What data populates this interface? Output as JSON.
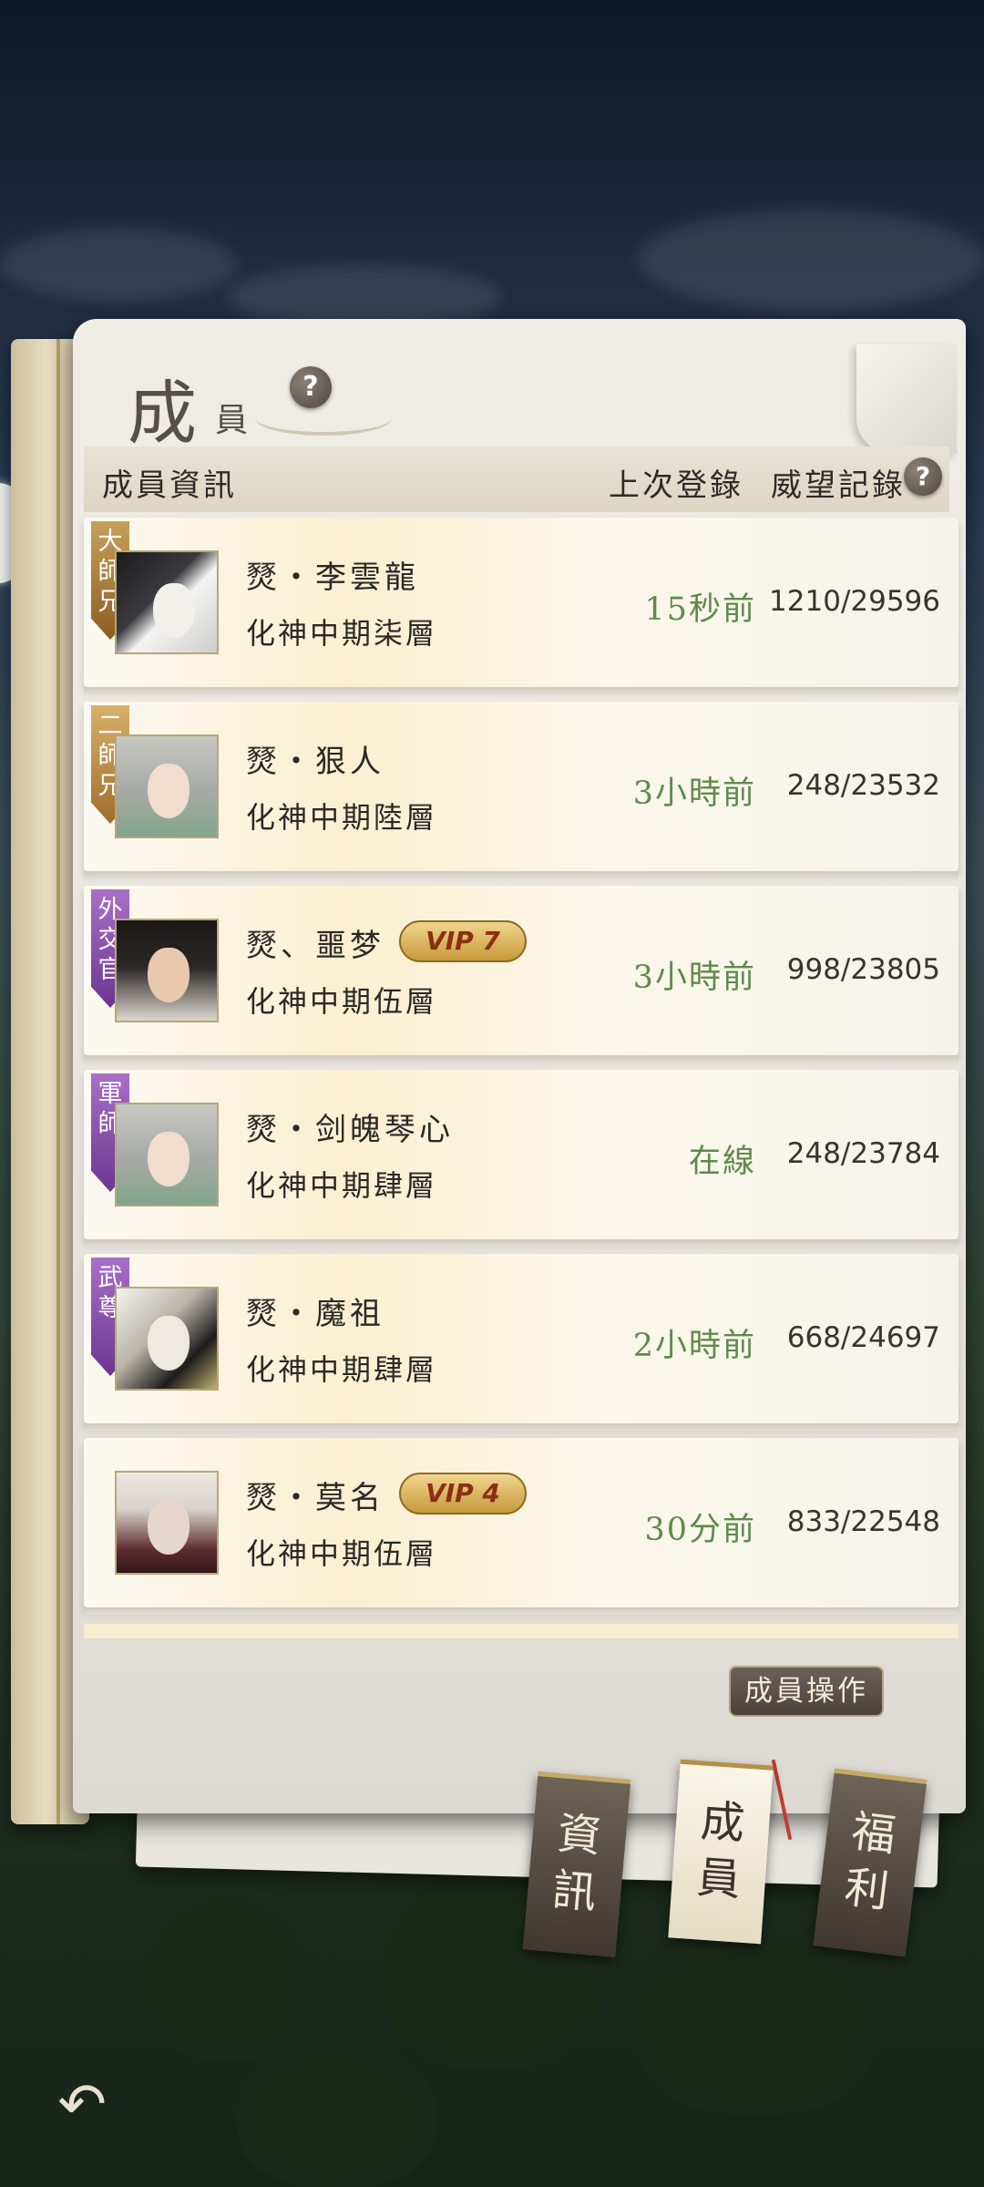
{
  "panel": {
    "title_big": "成",
    "title_small": "員"
  },
  "header": {
    "member_info": "成員資訊",
    "last_login": "上次登錄",
    "prestige": "威望記錄"
  },
  "help_icon": "?",
  "members": [
    {
      "rank": "大師兄",
      "rank_color": "#8a5e22",
      "name": "燹・李雲龍",
      "level": "化神中期柒層",
      "vip": "",
      "last_login": "15秒前",
      "prestige": "1210/29596"
    },
    {
      "rank": "二師兄",
      "rank_color": "#a06d2e",
      "name": "燹・狠人",
      "level": "化神中期陸層",
      "vip": "",
      "last_login": "3小時前",
      "prestige": "248/23532"
    },
    {
      "rank": "外交官",
      "rank_color": "#7a3fa0",
      "name": "燹、噩梦",
      "level": "化神中期伍層",
      "vip": "VIP 7",
      "last_login": "3小時前",
      "prestige": "998/23805"
    },
    {
      "rank": "軍師",
      "rank_color": "#7a3fa0",
      "name": "燹・剑魄琴心",
      "level": "化神中期肆層",
      "vip": "",
      "last_login": "在線",
      "prestige": "248/23784"
    },
    {
      "rank": "武尊",
      "rank_color": "#7a3fa0",
      "name": "燹・魔祖",
      "level": "化神中期肆層",
      "vip": "",
      "last_login": "2小時前",
      "prestige": "668/24697"
    },
    {
      "rank": "",
      "rank_color": "",
      "name": "燹・莫名",
      "level": "化神中期伍層",
      "vip": "VIP 4",
      "last_login": "30分前",
      "prestige": "833/22548"
    }
  ],
  "member_ops_button": "成員操作",
  "tabs": [
    {
      "label": "資\n訊",
      "active": false
    },
    {
      "label": "成\n員",
      "active": true
    },
    {
      "label": "福\n利",
      "active": false
    }
  ],
  "back_icon": "↶",
  "colors": {
    "online_green": "#5f8a4c",
    "page": "#efede6",
    "rank_gold": "#8a5e22",
    "rank_purple": "#7a3fa0"
  }
}
